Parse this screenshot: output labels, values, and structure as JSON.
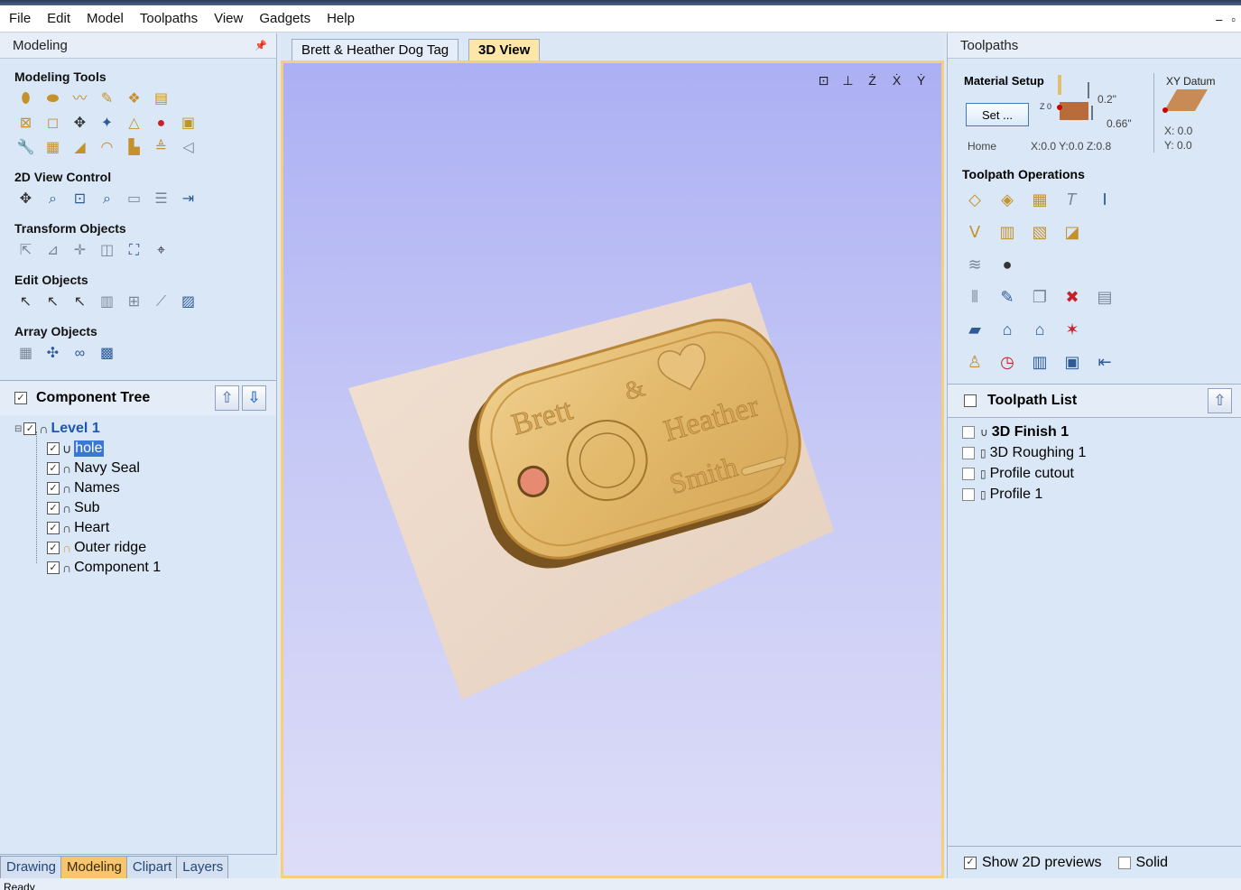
{
  "menu": [
    "File",
    "Edit",
    "Model",
    "Toolpaths",
    "View",
    "Gadgets",
    "Help"
  ],
  "window_controls": [
    "–",
    "▫"
  ],
  "left_panel": {
    "header": "Modeling",
    "sections": {
      "modeling_tools": "Modeling Tools",
      "view_control": "2D View Control",
      "transform": "Transform Objects",
      "edit": "Edit Objects",
      "array": "Array Objects"
    },
    "component_tree": {
      "title": "Component Tree",
      "level": "Level 1",
      "items": [
        "hole",
        "Navy Seal",
        "Names",
        "Sub",
        "Heart",
        "Outer ridge",
        "Component 1"
      ]
    },
    "bottom_tabs": [
      "Drawing",
      "Modeling",
      "Clipart",
      "Layers"
    ]
  },
  "doc_tabs": [
    "Brett & Heather Dog Tag",
    "3D View"
  ],
  "tag": {
    "name1": "Brett",
    "amp": "&",
    "name2": "Heather",
    "name3": "Smith"
  },
  "right_panel": {
    "header": "Toolpaths",
    "material_setup": "Material Setup",
    "set_button": "Set ...",
    "z0": "Z 0",
    "thickness_top": "0.2\"",
    "thickness_bottom": "0.66\"",
    "home_label": "Home",
    "home_coords": "X:0.0 Y:0.0 Z:0.8",
    "xy_datum": "XY Datum",
    "datum_x": "X: 0.0",
    "datum_y": "Y: 0.0",
    "toolpath_operations": "Toolpath Operations",
    "toolpath_list_title": "Toolpath List",
    "toolpaths": [
      "3D Finish 1",
      "3D Roughing 1",
      "Profile cutout",
      "Profile 1"
    ],
    "show_previews": "Show 2D previews",
    "solid": "Solid"
  },
  "status": "Ready",
  "colors": {
    "accent_tab": "#f6c56e",
    "viewport_top": "#acb0f4",
    "wood": "#e2b86a"
  }
}
